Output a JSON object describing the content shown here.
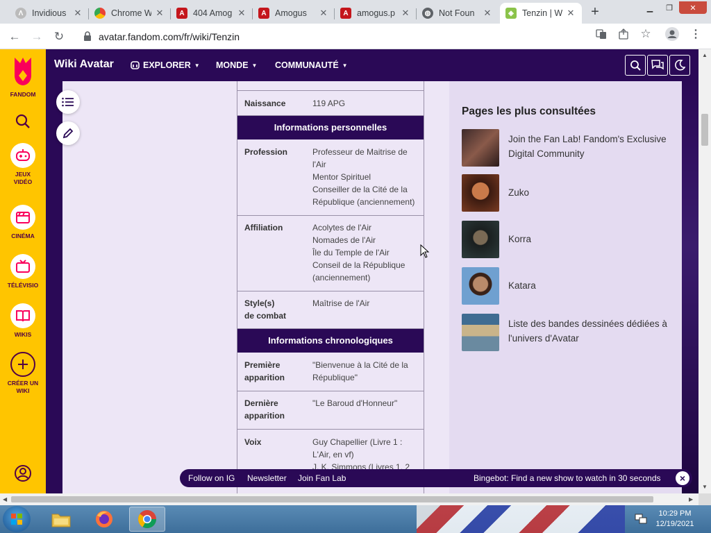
{
  "browser": {
    "tabs": [
      {
        "label": "Invidious",
        "active": false
      },
      {
        "label": "Chrome W",
        "active": false
      },
      {
        "label": "404 Amog",
        "active": false
      },
      {
        "label": "Amogus",
        "active": false
      },
      {
        "label": "amogus.p",
        "active": false
      },
      {
        "label": "Not Foun",
        "active": false
      },
      {
        "label": "Tenzin | W",
        "active": true
      }
    ],
    "url": "avatar.fandom.com/fr/wiki/Tenzin"
  },
  "rail": {
    "fandom_label": "FANDOM",
    "items": [
      {
        "label": "JEUX VIDÉO"
      },
      {
        "label": "CINÉMA"
      },
      {
        "label": "TÉLÉVISIO"
      },
      {
        "label": "WIKIS"
      },
      {
        "label": "CRÉER UN WIKI"
      }
    ]
  },
  "header": {
    "wiki_title": "Wiki Avatar",
    "nav": [
      {
        "label": "EXPLORER"
      },
      {
        "label": "MONDE"
      },
      {
        "label": "COMMUNAUTÉ"
      }
    ]
  },
  "infobox": {
    "birth_label": "Naissance",
    "birth_value": "119 APG",
    "section_personal": "Informations personnelles",
    "profession_label": "Profession",
    "profession_values": [
      "Professeur de Maitrise de",
      "l'Air",
      "Mentor Spirituel",
      "Conseiller de la Cité de la",
      "République (anciennement)"
    ],
    "affiliation_label": "Affiliation",
    "affiliation_values": [
      "Acolytes de l'Air",
      "Nomades de l'Air",
      "Île du Temple de l'Air",
      "Conseil de la République",
      "(anciennement)"
    ],
    "style_label_1": "Style(s)",
    "style_label_2": "de combat",
    "style_value": "Maîtrise de l'Air",
    "section_chrono": "Informations chronologiques",
    "first_label_1": "Première",
    "first_label_2": "apparition",
    "first_values": [
      "\"Bienvenue à la Cité de la",
      "République\""
    ],
    "last_label_1": "Dernière",
    "last_label_2": "apparition",
    "last_value": "\"Le Baroud d'Honneur\"",
    "voice_label": "Voix",
    "voice_values": [
      "Guy Chapellier (Livre 1 :",
      "L'Air, en vf)",
      "J. K. Simmons (Livres 1, 2"
    ]
  },
  "sidebar": {
    "title": "Pages les plus consultées",
    "items": [
      {
        "label": "Join the Fan Lab! Fandom's Exclusive Digital Community",
        "thumb_color": "#6b4a4a"
      },
      {
        "label": "Zuko",
        "thumb_color": "#7a3b22"
      },
      {
        "label": "Korra",
        "thumb_color": "#2d3b3b"
      },
      {
        "label": "Katara",
        "thumb_color": "#5a8bbf"
      },
      {
        "label": "Liste des bandes dessinées dédiées à l'univers d'Avatar",
        "thumb_color": "#3f6c92"
      }
    ]
  },
  "sticky": {
    "follow": "Follow on IG",
    "newsletter": "Newsletter",
    "fanlab": "Join Fan Lab",
    "bingebot": "Bingebot: Find a new show to watch in 30 seconds"
  },
  "taskbar": {
    "time": "10:29 PM",
    "date": "12/19/2021"
  },
  "colors": {
    "fandom_yellow": "#ffc500",
    "wiki_purple": "#2a0956",
    "content_bg": "#ede6f6"
  }
}
